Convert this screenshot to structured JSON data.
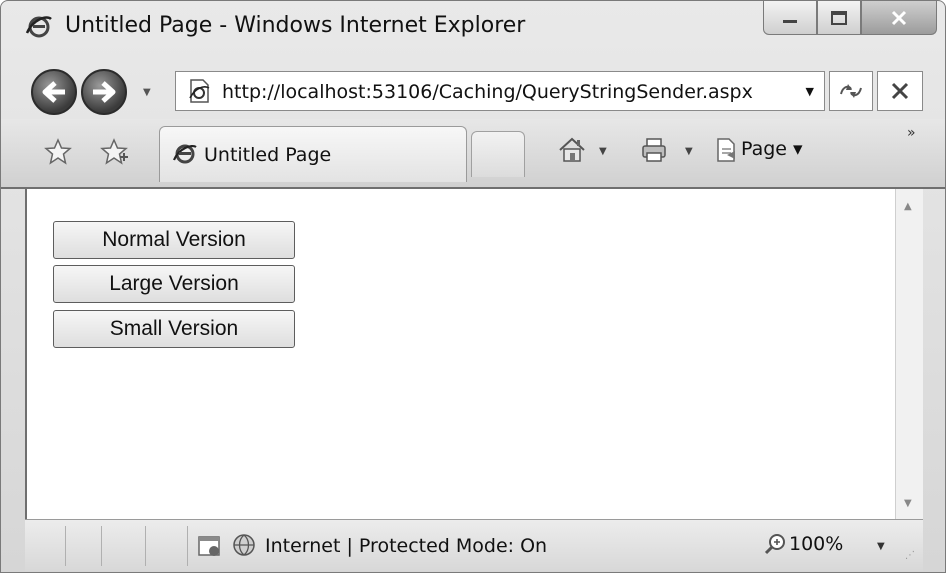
{
  "window": {
    "title": "Untitled Page - Windows Internet Explorer"
  },
  "address_bar": {
    "url": "http://localhost:53106/Caching/QueryStringSender.aspx"
  },
  "tabs": [
    {
      "label": "Untitled Page"
    }
  ],
  "toolbar": {
    "page_menu_label": "Page ▾"
  },
  "content": {
    "buttons": [
      {
        "label": "Normal Version"
      },
      {
        "label": "Large Version"
      },
      {
        "label": "Small Version"
      }
    ]
  },
  "status_bar": {
    "zone_text": "Internet | Protected Mode: On",
    "zoom": "100%"
  },
  "icons": {
    "app": "ie-logo-icon",
    "back": "back-arrow-icon",
    "forward": "forward-arrow-icon",
    "refresh": "refresh-icon",
    "stop": "stop-icon",
    "favorites": "favorites-star-icon",
    "add_favorites": "add-favorites-icon",
    "home": "home-icon",
    "print": "print-icon",
    "page": "page-icon",
    "zoom": "zoom-icon"
  }
}
